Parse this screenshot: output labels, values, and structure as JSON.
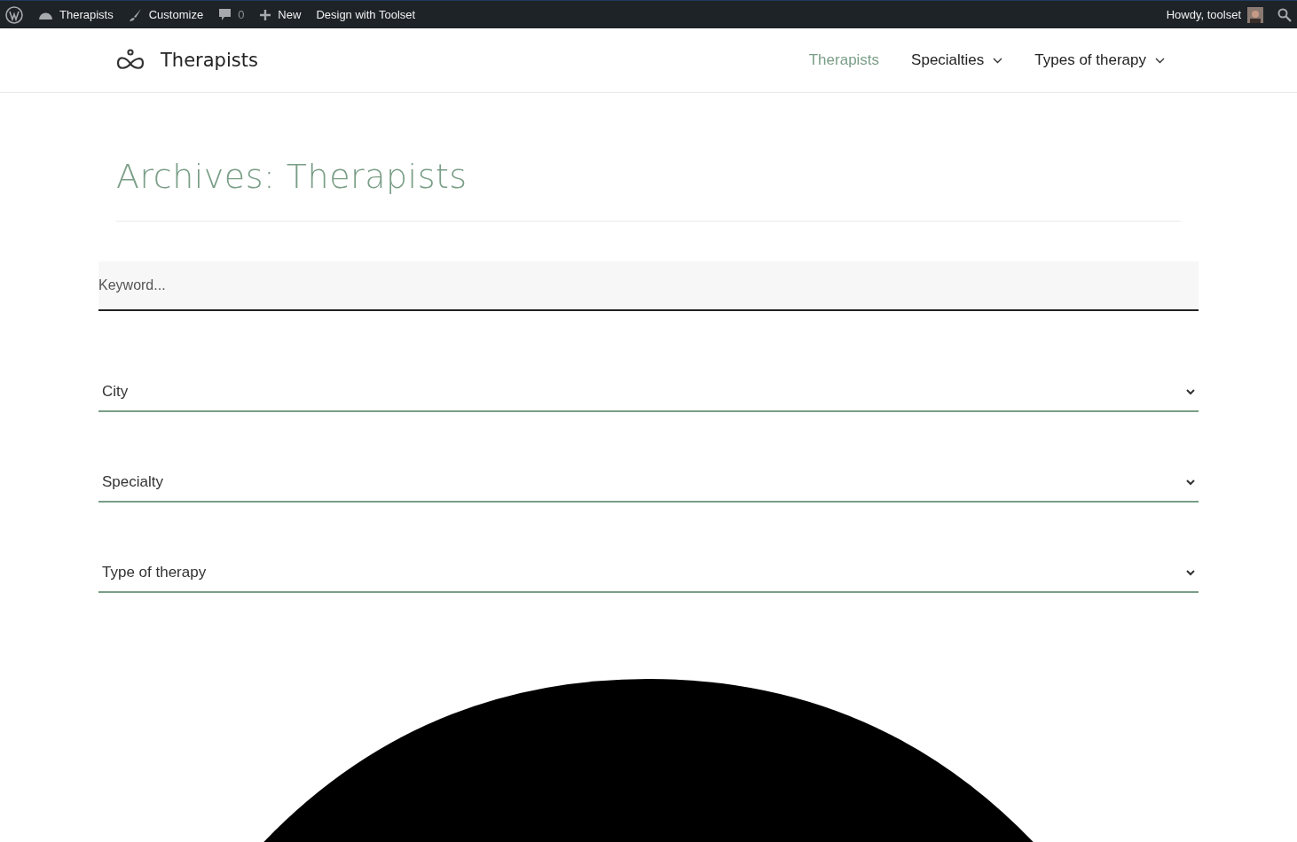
{
  "admin_bar": {
    "site": "Therapists",
    "customize": "Customize",
    "comments": "0",
    "new": "New",
    "toolset": "Design with Toolset",
    "greeting": "Howdy, toolset"
  },
  "header": {
    "logo": "Therapists",
    "nav": [
      {
        "label": "Therapists",
        "selected": true,
        "dropdown": false
      },
      {
        "label": "Specialties",
        "selected": false,
        "dropdown": true
      },
      {
        "label": "Types of therapy",
        "selected": false,
        "dropdown": true
      }
    ]
  },
  "page_title": "Archives: Therapists",
  "search": {
    "placeholder": "Keyword..."
  },
  "filters": [
    {
      "label": "City"
    },
    {
      "label": "Specialty"
    },
    {
      "label": "Type of therapy"
    }
  ]
}
